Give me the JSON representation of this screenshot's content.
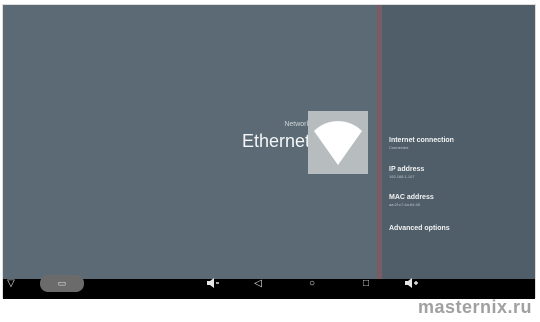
{
  "network": {
    "caption": "Network",
    "title": "Ethernet"
  },
  "options": [
    {
      "label": "Internet connection",
      "value": "Connected"
    },
    {
      "label": "IP address",
      "value": "192.168.1.107"
    },
    {
      "label": "MAC address",
      "value": "aa:2f:c7:4a:64:45"
    },
    {
      "label": "Advanced options",
      "value": ""
    }
  ],
  "navbar": {
    "icons": [
      "collapse-triangle-icon",
      "screenshot-icon",
      "volume-down-icon",
      "back-icon",
      "home-icon",
      "recents-icon",
      "volume-up-icon"
    ]
  },
  "watermark": "masternix.ru",
  "colors": {
    "main_bg": "#5b6a75",
    "side_panel_bg": "#4f5e69",
    "divider": "#7a5d64",
    "navbar_bg": "#000000"
  }
}
